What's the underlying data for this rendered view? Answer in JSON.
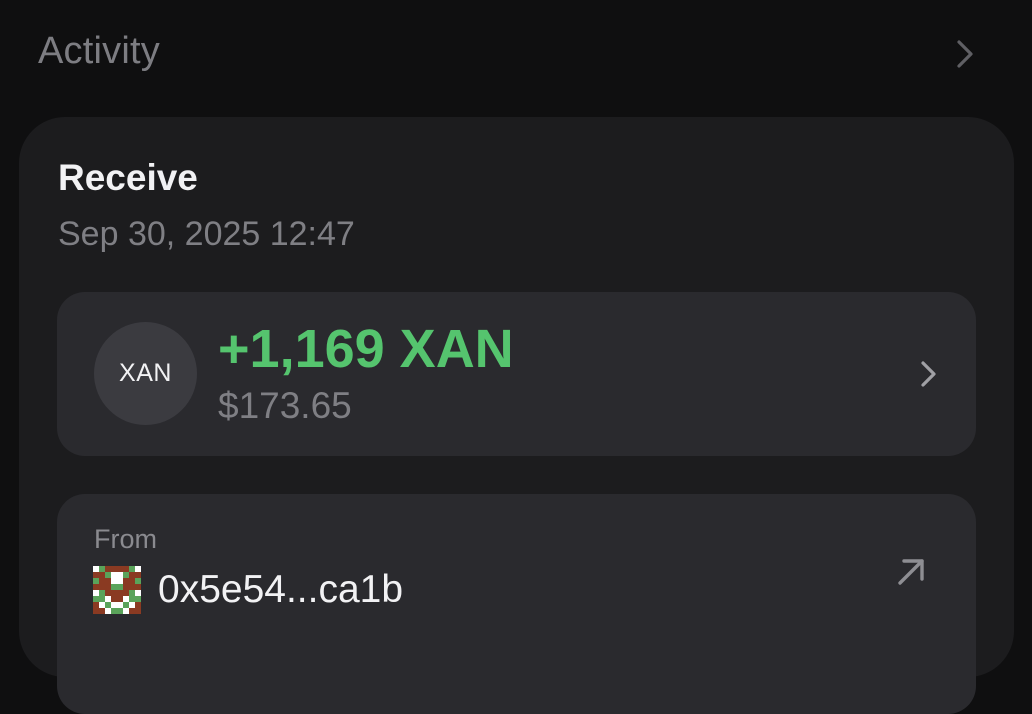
{
  "header": {
    "title": "Activity"
  },
  "transaction": {
    "type": "Receive",
    "date": "Sep 30, 2025 12:47",
    "token_symbol": "XAN",
    "amount": "+1,169 XAN",
    "fiat_value": "$173.65",
    "from_label": "From",
    "from_address": "0x5e54...ca1b"
  },
  "colors": {
    "positive_amount": "#55c46e",
    "background": "#0f0f10",
    "card": "#1c1c1e",
    "inner_box": "#2a2a2e"
  },
  "icons": {
    "header_chevron": "chevron-right-icon",
    "amount_chevron": "chevron-right-icon",
    "external_link": "arrow-up-right-icon",
    "sender_avatar": "identicon-avatar"
  }
}
